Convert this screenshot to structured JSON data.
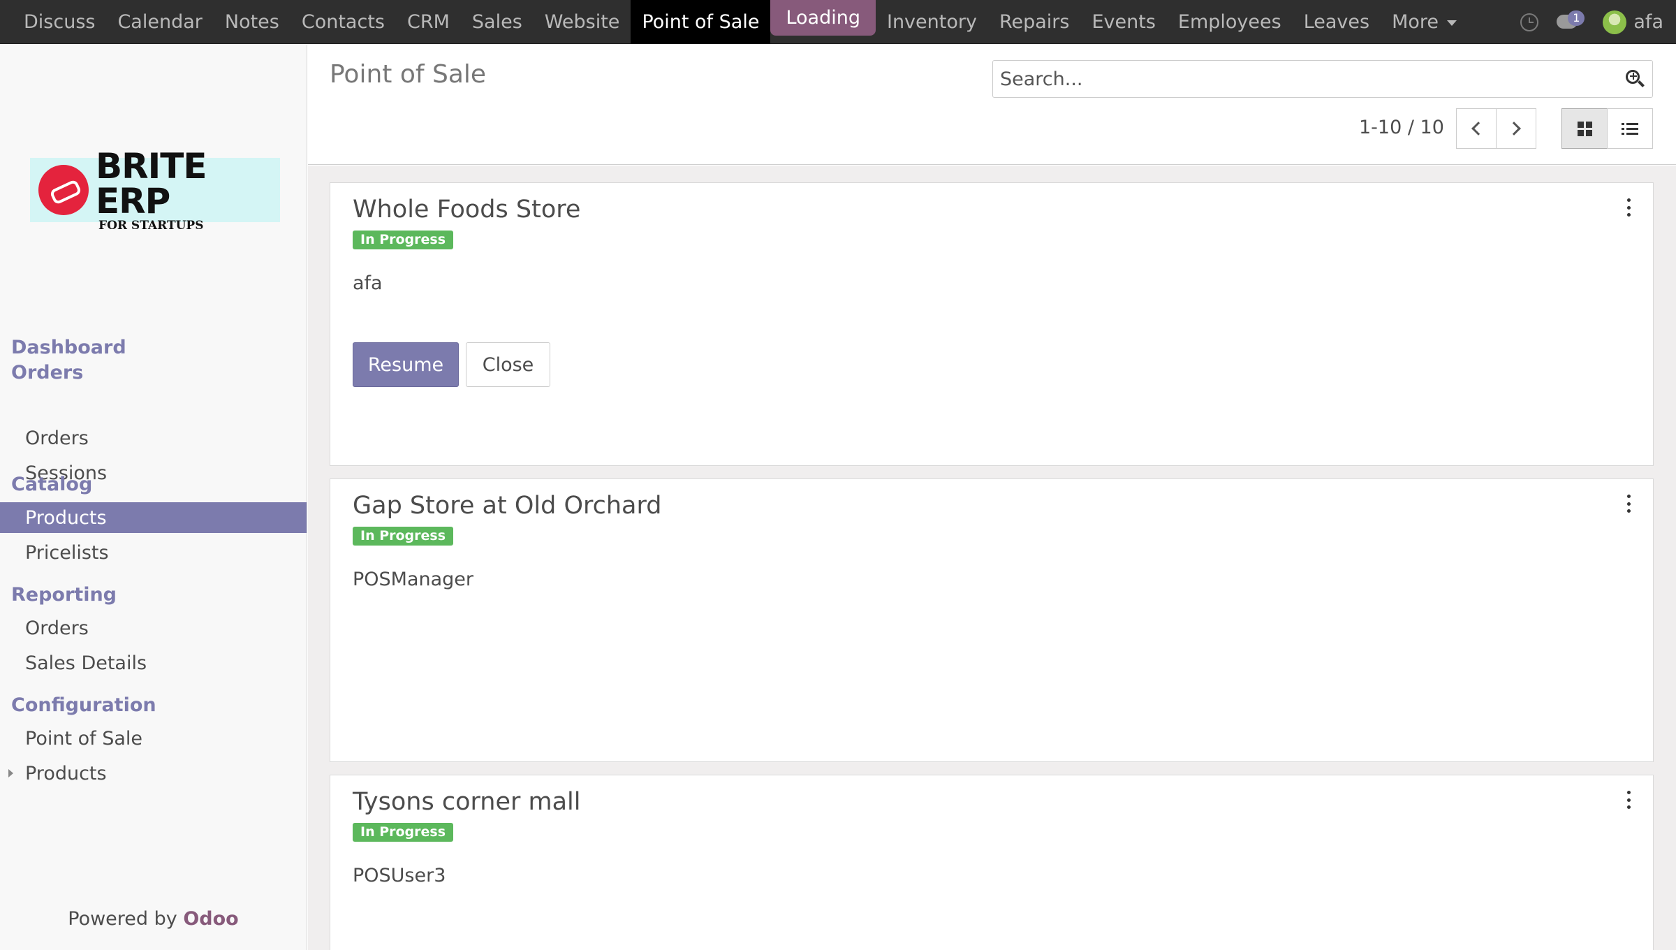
{
  "navbar": {
    "apps": [
      "Discuss",
      "Calendar",
      "Notes",
      "Contacts",
      "CRM",
      "Sales",
      "Website",
      "Point of Sale"
    ],
    "loading_label": "Loading",
    "apps_after": [
      "Inventory",
      "Repairs",
      "Events",
      "Employees",
      "Leaves"
    ],
    "more_label": "More",
    "chat_count": "1",
    "user_name": "afa",
    "active_app": "Point of Sale"
  },
  "sidebar": {
    "logo_title": "BRITE ERP",
    "logo_subtitle": "FOR STARTUPS",
    "sections": {
      "dashboard": "Dashboard",
      "orders": "Orders",
      "catalog": "Catalog",
      "reporting": "Reporting",
      "configuration": "Configuration"
    },
    "items": {
      "orders_orders": "Orders",
      "orders_sessions": "Sessions",
      "catalog_products": "Products",
      "catalog_pricelists": "Pricelists",
      "reporting_orders": "Orders",
      "reporting_sales_details": "Sales Details",
      "config_pos": "Point of Sale",
      "config_products": "Products"
    },
    "selected_item": "Products",
    "powered_by": "Powered by",
    "powered_brand": "Odoo"
  },
  "control_panel": {
    "breadcrumb": "Point of Sale",
    "search_placeholder": "Search...",
    "pager": "1-10 / 10"
  },
  "cards": [
    {
      "title": "Whole Foods Store",
      "status": "In Progress",
      "user": "afa",
      "resume_label": "Resume",
      "close_label": "Close"
    },
    {
      "title": "Gap Store at Old Orchard",
      "status": "In Progress",
      "user": "POSManager"
    },
    {
      "title": "Tysons corner mall",
      "status": "In Progress",
      "user": "POSUser3"
    }
  ],
  "colors": {
    "navbar_bg": "#2f2f2f",
    "accent": "#7c7bad",
    "loading_bg": "#875a7b",
    "status_green": "#5cb85c"
  }
}
